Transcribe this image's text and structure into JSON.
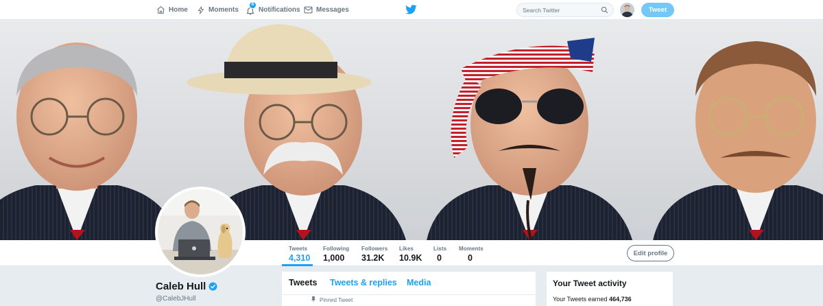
{
  "nav": {
    "home": "Home",
    "moments": "Moments",
    "notifications": "Notifications",
    "notification_count": "6",
    "messages": "Messages",
    "search_placeholder": "Search Twitter",
    "tweet_button": "Tweet"
  },
  "profile_nav": {
    "stats": [
      {
        "label": "Tweets",
        "value": "4,310"
      },
      {
        "label": "Following",
        "value": "1,000"
      },
      {
        "label": "Followers",
        "value": "31.2K"
      },
      {
        "label": "Likes",
        "value": "10.9K"
      },
      {
        "label": "Lists",
        "value": "0"
      },
      {
        "label": "Moments",
        "value": "0"
      }
    ],
    "edit_profile": "Edit profile"
  },
  "profile": {
    "name": "Caleb Hull",
    "handle": "@CalebJHull"
  },
  "timeline": {
    "tabs": [
      "Tweets",
      "Tweets & replies",
      "Media"
    ],
    "pinned_label": "Pinned Tweet"
  },
  "activity": {
    "title": "Your Tweet activity",
    "text_prefix": "Your Tweets earned ",
    "impressions": "464,736"
  },
  "colors": {
    "accent": "#1da1f2",
    "tweet_button": "#74c8f5",
    "background": "#e6ecf0"
  }
}
